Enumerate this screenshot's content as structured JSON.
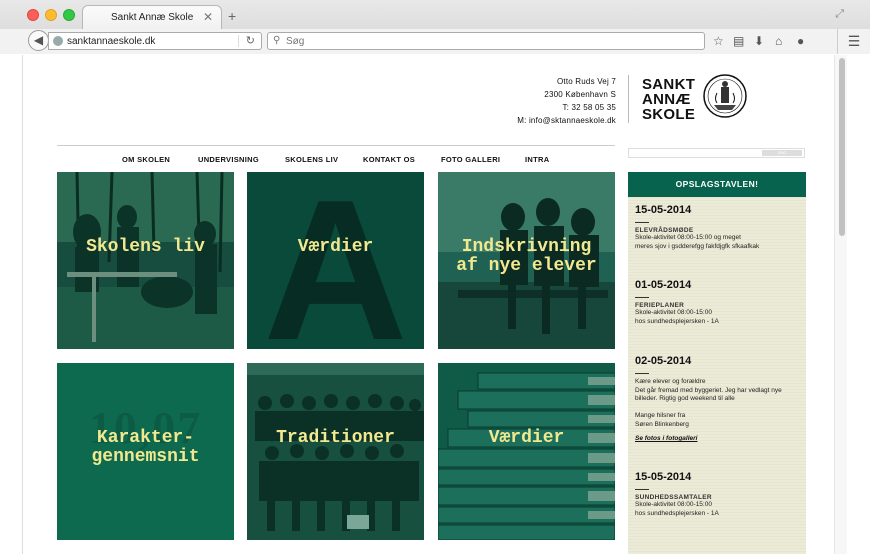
{
  "browser": {
    "tab_title": "Sankt Annæ Skole",
    "url": "sanktannaeskole.dk",
    "search_placeholder": "Søg"
  },
  "header": {
    "address_lines": [
      "Otto Ruds Vej 7",
      "2300 København S",
      "T:  32 58 05 35",
      "M: info@sktannaeskole.dk"
    ],
    "logo_lines": [
      "SANKT",
      "ANNÆ",
      "SKOLE"
    ]
  },
  "nav": {
    "items": [
      "OM SKOLEN",
      "UNDERVISNING",
      "SKOLENS LIV",
      "KONTAKT OS",
      "FOTO GALLERI",
      "INTRA"
    ]
  },
  "site_search": {
    "button": "SØG"
  },
  "tiles": [
    {
      "label_lines": [
        "Skolens liv"
      ]
    },
    {
      "label_lines": [
        "Værdier"
      ],
      "big_letter": "A"
    },
    {
      "label_lines": [
        "Indskrivning",
        "af nye elever"
      ]
    },
    {
      "label_lines": [
        "Karakter-",
        "gennemsnit"
      ],
      "big_number": "10,07"
    },
    {
      "label_lines": [
        "Traditioner"
      ]
    },
    {
      "label_lines": [
        "Værdier"
      ]
    }
  ],
  "board": {
    "title": "OPSLAGSTAVLEN!",
    "posts": [
      {
        "date": "15-05-2014",
        "heading": "ELEVRÅDSMØDE",
        "lines": [
          "Skole-aktivitet 08:00-15:00  og meget",
          "meres sjov i gsdderefgg  fakfdjgfk sfkaafkak"
        ],
        "link": ""
      },
      {
        "date": "01-05-2014",
        "heading": "FERIEPLANER",
        "lines": [
          "Skole-aktivitet 08:00-15:00",
          "hos sundhedsplejersken - 1A"
        ],
        "link": ""
      },
      {
        "date": "02-05-2014",
        "heading": "",
        "lines": [
          "Kære elever og forældre",
          "Det går fremad med byggeriet. Jeg har vedlagt nye",
          "billeder. Rigtig god weekend til alle",
          "",
          "Mange hilsner fra",
          "Søren Blinkenberg"
        ],
        "link": "Se fotos i fotogalleri"
      },
      {
        "date": "15-05-2014",
        "heading": "SUNDHEDSSAMTALER",
        "lines": [
          "Skole-aktivitet 08:00-15:00",
          "hos sundhedsplejersken - 1A"
        ],
        "link": ""
      }
    ]
  },
  "colors": {
    "brand_green": "#08634e",
    "tile_label": "#f2e890",
    "tile_dark": "#0c4a3c",
    "tile_mid": "#0e6a4e"
  }
}
